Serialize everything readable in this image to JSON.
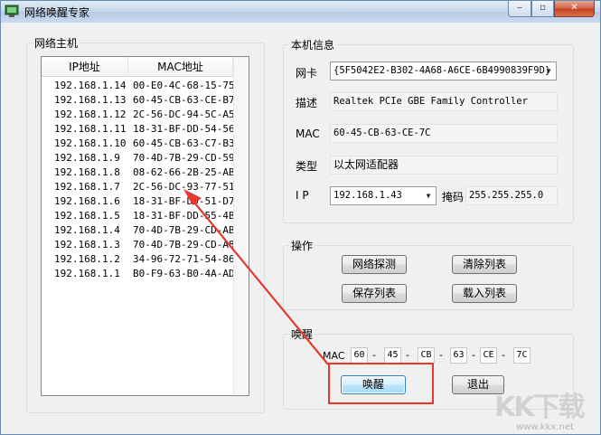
{
  "window": {
    "title": "网络唤醒专家",
    "minimize_glyph": "‒",
    "maximize_glyph": "▫",
    "close_glyph": "✕"
  },
  "host_list": {
    "group_label": "网络主机",
    "columns": [
      "IP地址",
      "MAC地址"
    ],
    "rows": [
      {
        "ip": "192.168.1.14",
        "mac": "00-E0-4C-68-15-75"
      },
      {
        "ip": "192.168.1.13",
        "mac": "60-45-CB-63-CE-B7"
      },
      {
        "ip": "192.168.1.12",
        "mac": "2C-56-DC-94-5C-A5"
      },
      {
        "ip": "192.168.1.11",
        "mac": "18-31-BF-DD-54-56"
      },
      {
        "ip": "192.168.1.10",
        "mac": "60-45-CB-63-C7-B3"
      },
      {
        "ip": "192.168.1.9",
        "mac": "70-4D-7B-29-CD-59"
      },
      {
        "ip": "192.168.1.8",
        "mac": "08-62-66-2B-25-AB"
      },
      {
        "ip": "192.168.1.7",
        "mac": "2C-56-DC-93-77-51"
      },
      {
        "ip": "192.168.1.6",
        "mac": "18-31-BF-DD-51-D7"
      },
      {
        "ip": "192.168.1.5",
        "mac": "18-31-BF-DD-55-4B"
      },
      {
        "ip": "192.168.1.4",
        "mac": "70-4D-7B-29-CD-AB"
      },
      {
        "ip": "192.168.1.3",
        "mac": "70-4D-7B-29-CD-A8"
      },
      {
        "ip": "192.168.1.2",
        "mac": "34-96-72-71-54-86"
      },
      {
        "ip": "192.168.1.1",
        "mac": "B0-F9-63-B0-4A-AD"
      }
    ]
  },
  "local_info": {
    "group_label": "本机信息",
    "nic_label": "网卡",
    "nic_value": "{5F5042E2-B302-4A68-A6CE-6B4990839F9D}",
    "desc_label": "描述",
    "desc_value": "Realtek PCIe GBE Family Controller",
    "mac_label": "MAC",
    "mac_value": "60-45-CB-63-CE-7C",
    "type_label": "类型",
    "type_value": "以太网适配器",
    "ip_label": "I P",
    "ip_value": "192.168.1.43",
    "mask_label": "掩码",
    "mask_value": "255.255.255.0"
  },
  "operations": {
    "group_label": "操作",
    "probe_label": "网络探测",
    "clear_label": "清除列表",
    "save_label": "保存列表",
    "load_label": "载入列表"
  },
  "wake": {
    "group_label": "唤醒",
    "mac_label": "MAC",
    "mac_parts": [
      "60",
      "45",
      "CB",
      "63",
      "CE",
      "7C"
    ],
    "separator": "-",
    "wake_label": "唤醒",
    "exit_label": "退出"
  },
  "watermark": {
    "big": "KK下载",
    "small": "www.kkx.net"
  },
  "colors": {
    "annotation_red": "#e8372c"
  }
}
